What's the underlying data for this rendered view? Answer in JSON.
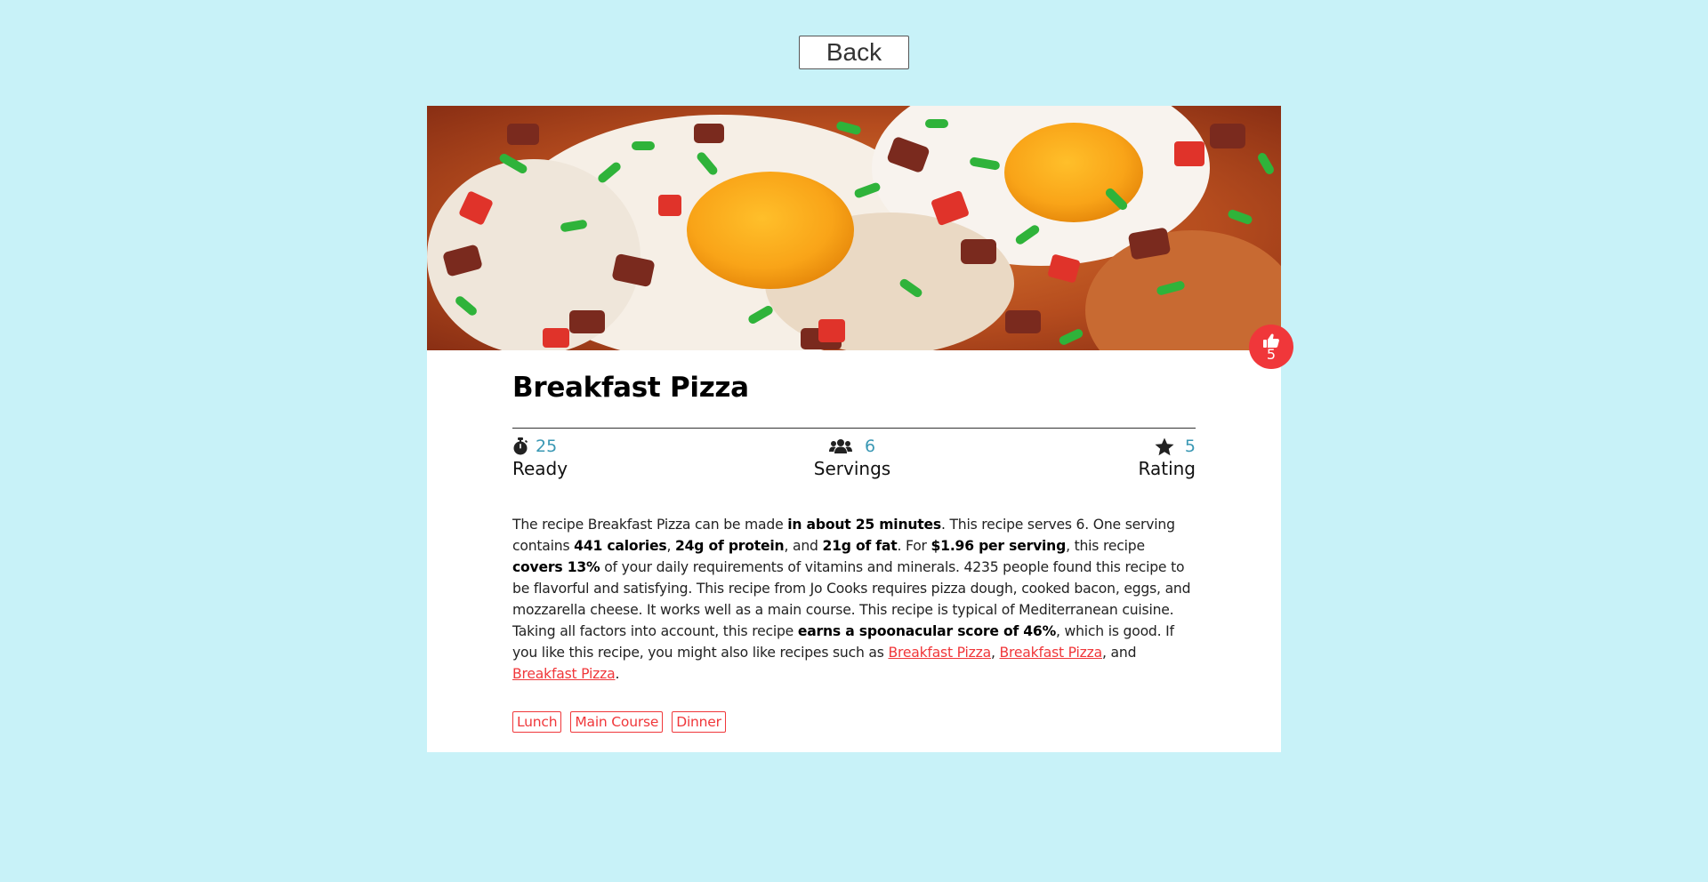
{
  "nav": {
    "back_label": "Back"
  },
  "recipe": {
    "title": "Breakfast Pizza",
    "likes": "5",
    "hero_icon": "recipe-photo",
    "stats": {
      "ready": {
        "value": "25",
        "label": "Ready",
        "icon": "stopwatch-icon"
      },
      "servings": {
        "value": "6",
        "label": "Servings",
        "icon": "users-icon"
      },
      "rating": {
        "value": "5",
        "label": "Rating",
        "icon": "star-icon"
      }
    },
    "description": {
      "p1": "The recipe Breakfast Pizza can be made ",
      "b1": "in about 25 minutes",
      "p2": ". This recipe serves 6. One serving contains ",
      "b2": "441 calories",
      "p3": ", ",
      "b3": "24g of protein",
      "p4": ", and ",
      "b4": "21g of fat",
      "p5": ". For ",
      "b5": "$1.96 per serving",
      "p6": ", this recipe ",
      "b6": "covers 13%",
      "p7": " of your daily requirements of vitamins and minerals. 4235 people found this recipe to be flavorful and satisfying. This recipe from Jo Cooks requires pizza dough, cooked bacon, eggs, and mozzarella cheese. It works well as a main course. This recipe is typical of Mediterranean cuisine. Taking all factors into account, this recipe ",
      "b7": "earns a spoonacular score of 46%",
      "p8": ", which is good. If you like this recipe, you might also like recipes such as ",
      "link1": "Breakfast Pizza",
      "p9": ", ",
      "link2": "Breakfast Pizza",
      "p10": ", and ",
      "link3": "Breakfast Pizza",
      "p11": "."
    },
    "tags": [
      "Lunch",
      "Main Course",
      "Dinner"
    ]
  },
  "colors": {
    "background": "#c8f2f8",
    "accent_red": "#f0373a",
    "stat_value_blue": "#3a98b4"
  }
}
